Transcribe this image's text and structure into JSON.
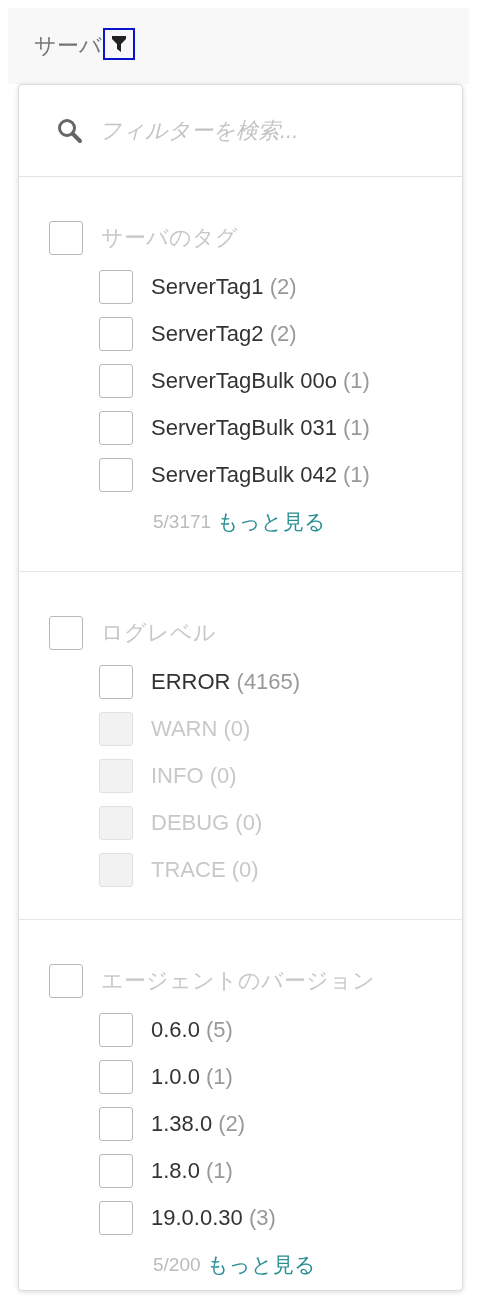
{
  "column_header": {
    "title": "サーバ"
  },
  "filter_panel": {
    "search": {
      "placeholder": "フィルターを検索..."
    },
    "groups": [
      {
        "title": "サーバのタグ",
        "checked": false,
        "items": [
          {
            "label": "ServerTag1",
            "count": "(2)",
            "checked": false,
            "disabled": false
          },
          {
            "label": "ServerTag2",
            "count": "(2)",
            "checked": false,
            "disabled": false
          },
          {
            "label": "ServerTagBulk 00o",
            "count": "(1)",
            "checked": false,
            "disabled": false
          },
          {
            "label": "ServerTagBulk 031",
            "count": "(1)",
            "checked": false,
            "disabled": false
          },
          {
            "label": "ServerTagBulk 042",
            "count": "(1)",
            "checked": false,
            "disabled": false
          }
        ],
        "more": {
          "count": "5/3171",
          "link": "もっと見る"
        }
      },
      {
        "title": "ログレベル",
        "checked": false,
        "items": [
          {
            "label": "ERROR",
            "count": "(4165)",
            "checked": false,
            "disabled": false
          },
          {
            "label": "WARN",
            "count": "(0)",
            "checked": false,
            "disabled": true
          },
          {
            "label": "INFO",
            "count": "(0)",
            "checked": false,
            "disabled": true
          },
          {
            "label": "DEBUG",
            "count": "(0)",
            "checked": false,
            "disabled": true
          },
          {
            "label": "TRACE",
            "count": "(0)",
            "checked": false,
            "disabled": true
          }
        ]
      },
      {
        "title": "エージェントのバージョン",
        "checked": false,
        "items": [
          {
            "label": "0.6.0",
            "count": "(5)",
            "checked": false,
            "disabled": false
          },
          {
            "label": "1.0.0",
            "count": "(1)",
            "checked": false,
            "disabled": false
          },
          {
            "label": "1.38.0",
            "count": "(2)",
            "checked": false,
            "disabled": false
          },
          {
            "label": "1.8.0",
            "count": "(1)",
            "checked": false,
            "disabled": false
          },
          {
            "label": "19.0.0.30",
            "count": "(3)",
            "checked": false,
            "disabled": false
          }
        ],
        "more": {
          "count": "5/200",
          "link": "もっと見る"
        }
      }
    ]
  }
}
